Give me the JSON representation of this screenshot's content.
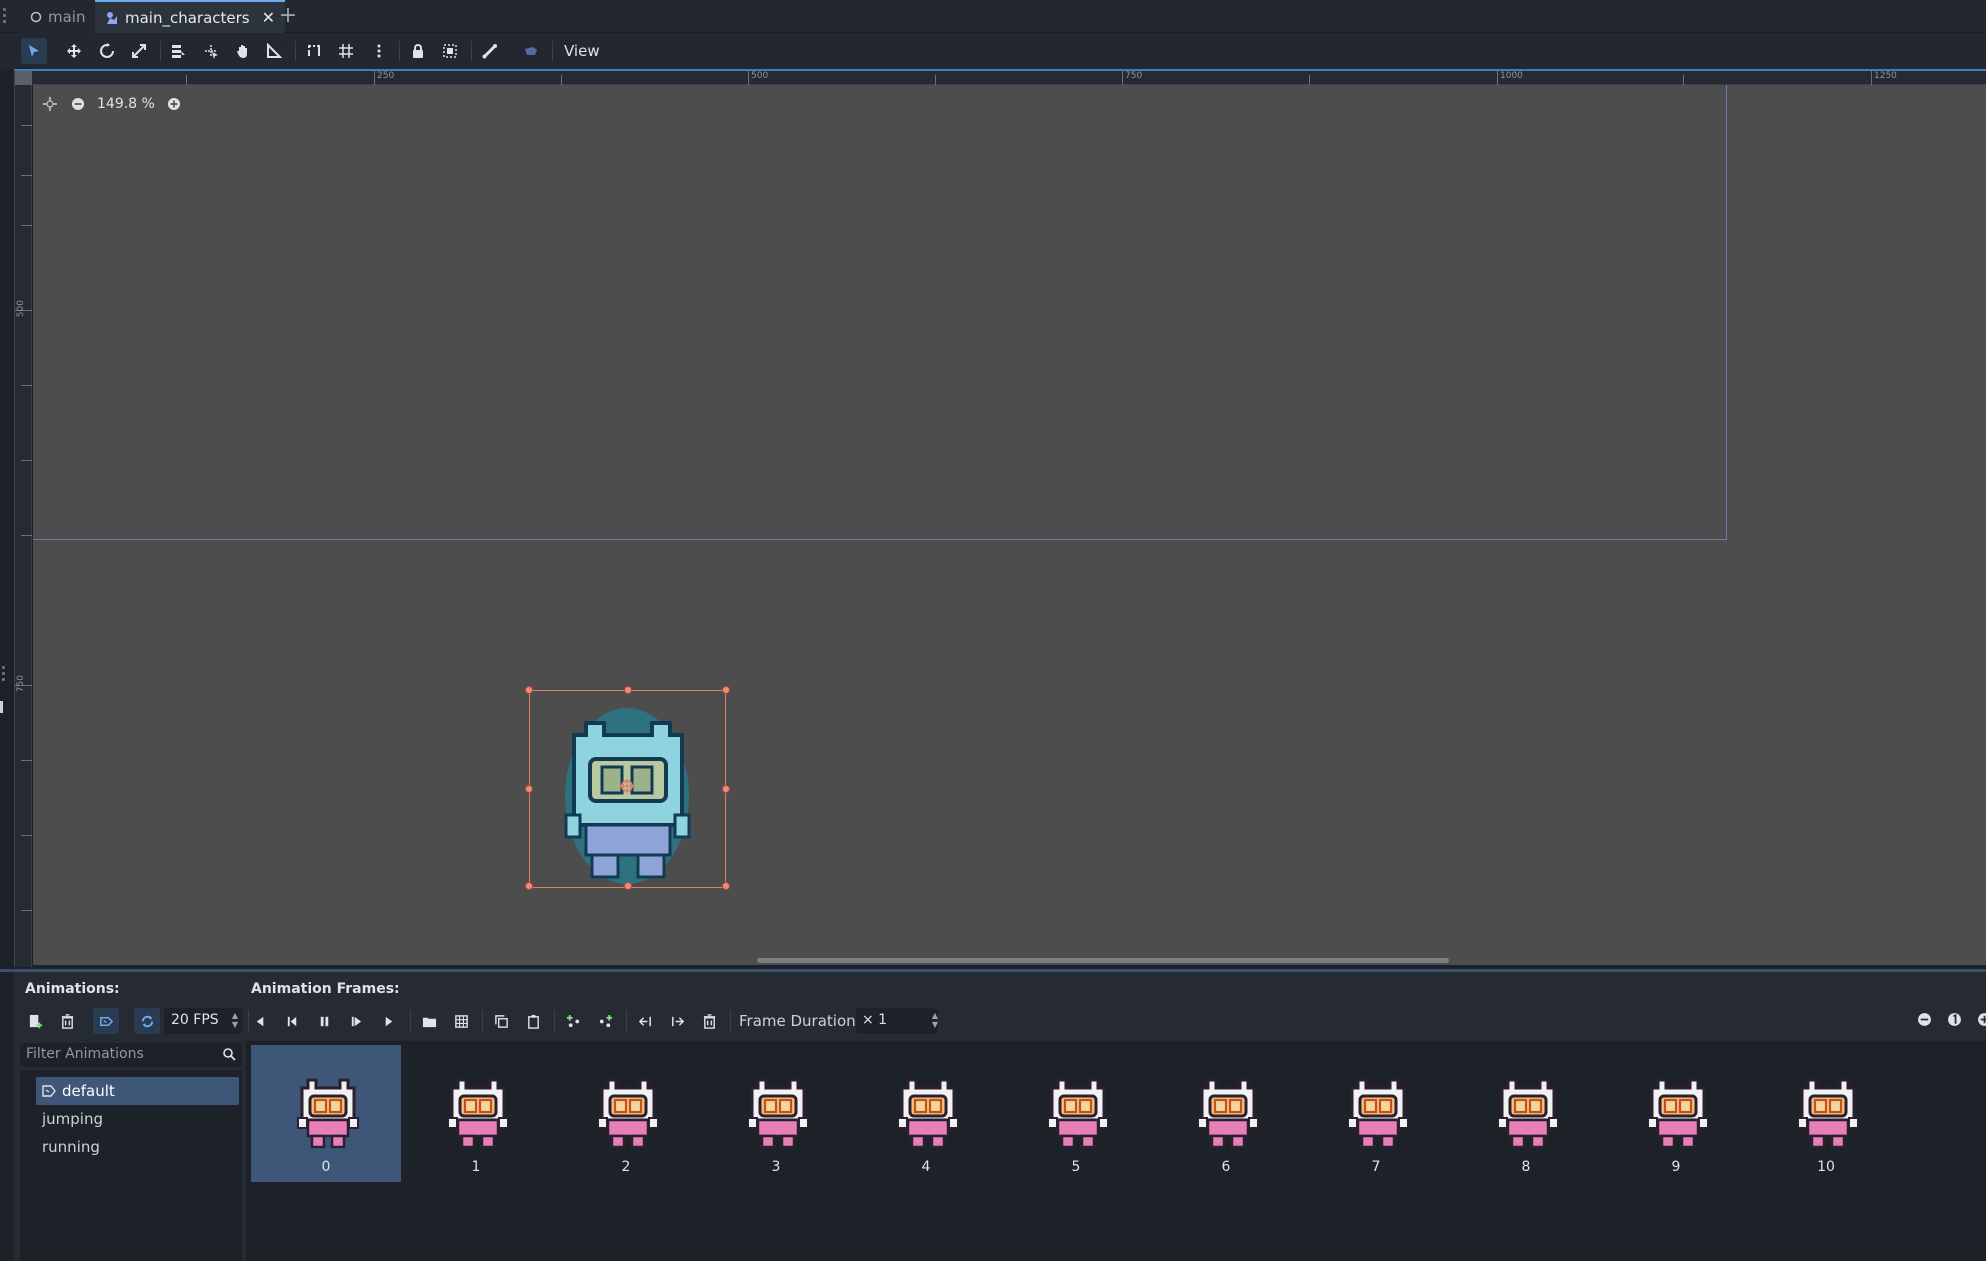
{
  "tabs": [
    {
      "label": "main",
      "icon": "circle-icon"
    },
    {
      "label": "main_characters",
      "icon": "animated-sprite-icon"
    }
  ],
  "toolbar": {
    "view_label": "View",
    "tools": [
      "select-tool-icon",
      "move-tool-icon",
      "rotate-tool-icon",
      "scale-tool-icon",
      "list-select-icon",
      "pivot-icon",
      "pan-icon",
      "ruler-icon",
      "smart-snap-icon",
      "grid-snap-icon",
      "more-icon",
      "lock-icon",
      "group-icon",
      "skeleton-icon",
      "camera-override-icon"
    ]
  },
  "viewport": {
    "zoom": "149.8 %",
    "ruler_h": [
      "250",
      "500",
      "750",
      "1000",
      "1250"
    ],
    "ruler_v": [
      "500",
      "750"
    ]
  },
  "panel": {
    "animations_title": "Animations:",
    "frames_title": "Animation Frames:",
    "fps": "20 FPS",
    "frame_duration_label": "Frame Duration:",
    "frame_duration_value": "× 1",
    "filter_placeholder": "Filter Animations",
    "animations": [
      "default",
      "jumping",
      "running"
    ],
    "selected_animation": "default",
    "frames": [
      "0",
      "1",
      "2",
      "3",
      "4",
      "5",
      "6",
      "7",
      "8",
      "9",
      "10"
    ],
    "selected_frame": "0"
  },
  "colors": {
    "accent": "#6eaaf0",
    "selection": "#3e5779",
    "canvas": "#4d4d4d",
    "sprite_outline": "#e08060"
  }
}
